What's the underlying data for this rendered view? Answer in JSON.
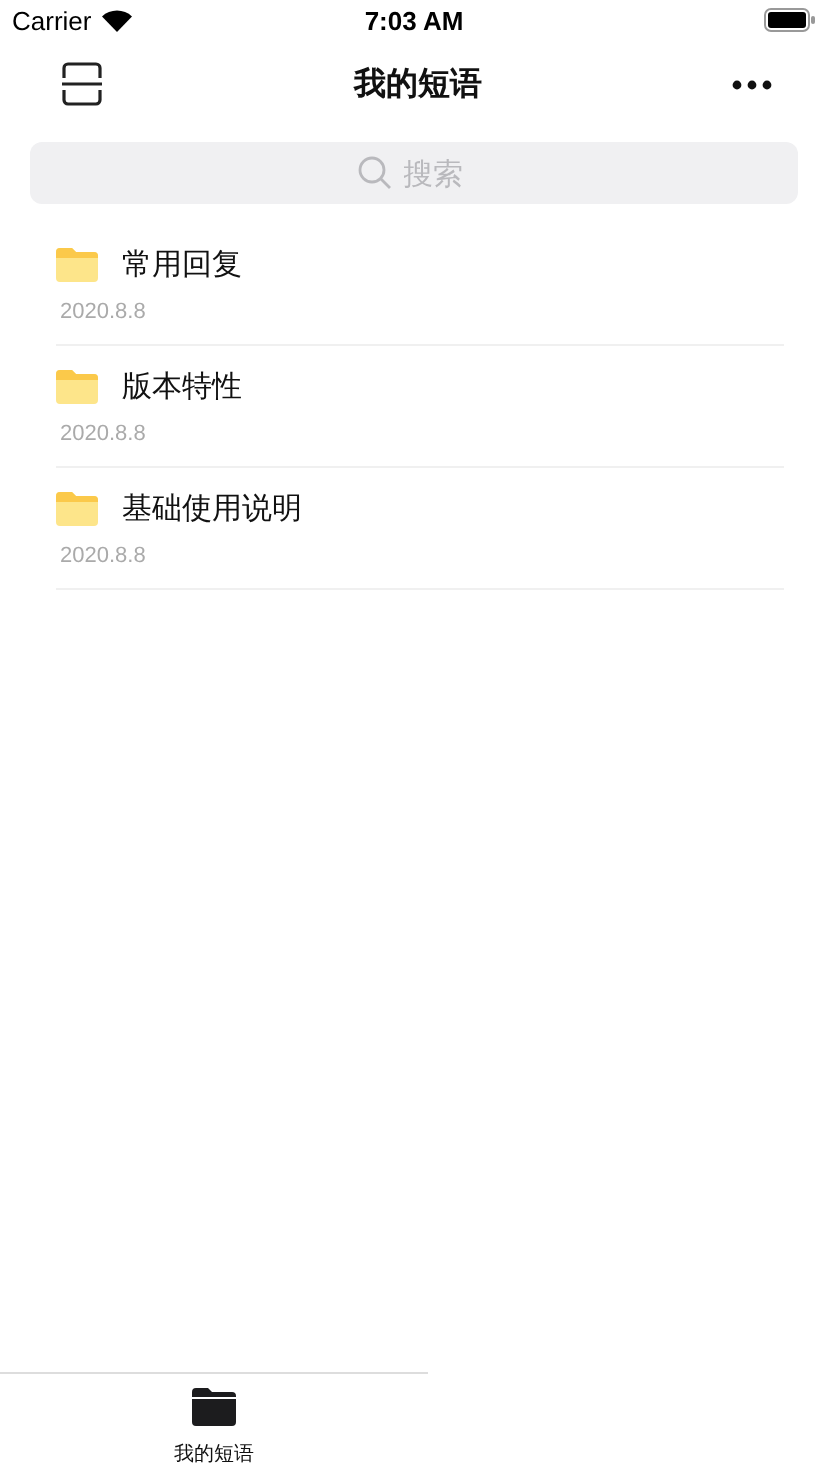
{
  "status_bar": {
    "carrier": "Carrier",
    "time": "7:03 AM"
  },
  "nav_bar": {
    "title": "我的短语"
  },
  "search": {
    "placeholder": "搜索"
  },
  "folders": [
    {
      "name": "常用回复",
      "date": "2020.8.8"
    },
    {
      "name": "版本特性",
      "date": "2020.8.8"
    },
    {
      "name": "基础使用说明",
      "date": "2020.8.8"
    }
  ],
  "tab_bar": [
    {
      "label": "我的短语",
      "selected": true
    }
  ]
}
